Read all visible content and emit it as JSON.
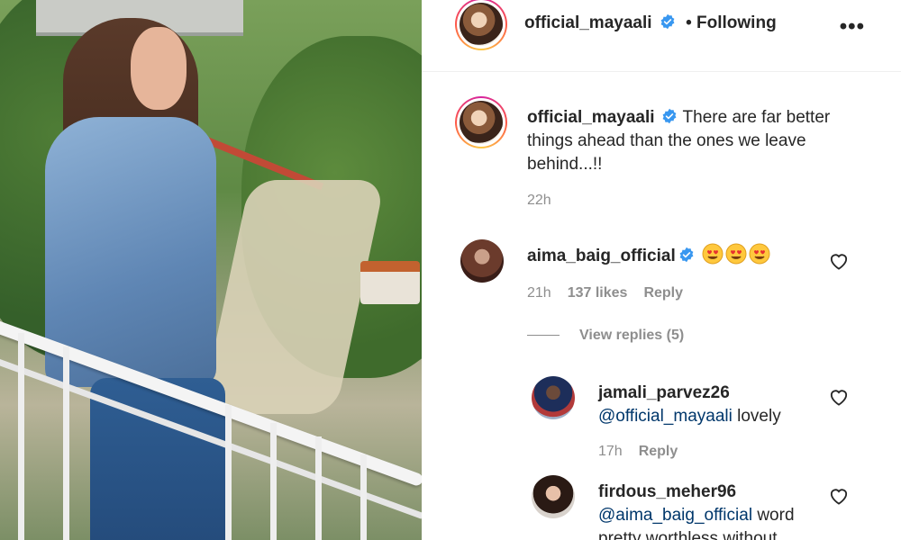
{
  "post": {
    "author": "official_mayaali",
    "follow_state": "• Following",
    "more_icon": "more-options-icon",
    "caption_text": "There are far better things ahead than the ones we leave behind...!!",
    "caption_time": "22h"
  },
  "comments": [
    {
      "username": "aima_baig_official",
      "text": "",
      "emoji_count": 3,
      "time": "21h",
      "likes": "137 likes",
      "reply_label": "Reply"
    }
  ],
  "view_replies": "View replies (5)",
  "replies": [
    {
      "username": "jamali_parvez26",
      "mention": "@official_mayaali",
      "text": " lovely",
      "time": "17h",
      "reply_label": "Reply"
    },
    {
      "username": "firdous_meher96",
      "mention": "@aima_baig_official",
      "text": " word",
      "text_line2": "pretty worthless without"
    }
  ],
  "colors": {
    "verified_blue": "#3897f0",
    "mention_blue": "#00376b",
    "meta_gray": "#8e8e8e"
  }
}
